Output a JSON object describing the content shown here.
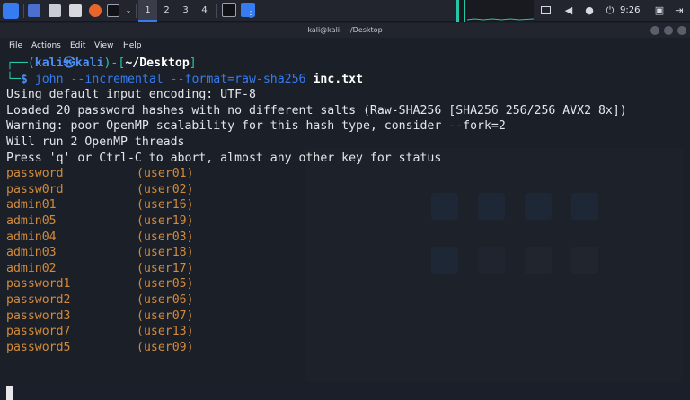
{
  "taskbar": {
    "workspaces": [
      "1",
      "2",
      "3",
      "4"
    ],
    "active_workspace": 0,
    "task_badge": "3",
    "clock": "9:26",
    "accent": "#367bf0",
    "icons": [
      "kali-menu-icon",
      "desktop-icon",
      "files-icon",
      "text-editor-icon",
      "firefox-icon",
      "terminal-icon",
      "chevron-down-icon",
      "terminal-task-icon",
      "file-manager-task-icon",
      "screen-icon",
      "volume-icon",
      "notifications-icon",
      "power-icon",
      "lock-icon",
      "logout-icon"
    ]
  },
  "window": {
    "title": "kali@kali: ~/Desktop"
  },
  "menu": {
    "file": "File",
    "actions": "Actions",
    "edit": "Edit",
    "view": "View",
    "help": "Help"
  },
  "prompt": {
    "open": "┌──(",
    "user": "kali",
    "at": "㉿",
    "host": "kali",
    "mid": ")-[",
    "path": "~/Desktop",
    "close": "]",
    "line2": "└─",
    "dollar": "$",
    "cmd": "john --incremental --format=raw-sha256",
    "arg": "inc.txt"
  },
  "output": [
    "Using default input encoding: UTF-8",
    "Loaded 20 password hashes with no different salts (Raw-SHA256 [SHA256 256/256 AVX2 8x])",
    "Warning: poor OpenMP scalability for this hash type, consider --fork=2",
    "Will run 2 OpenMP threads",
    "Press 'q' or Ctrl-C to abort, almost any other key for status"
  ],
  "cracked": [
    {
      "password": "password",
      "user": "(user01)"
    },
    {
      "password": "passw0rd",
      "user": "(user02)"
    },
    {
      "password": "admin01",
      "user": "(user16)"
    },
    {
      "password": "admin05",
      "user": "(user19)"
    },
    {
      "password": "admin04",
      "user": "(user03)"
    },
    {
      "password": "admin03",
      "user": "(user18)"
    },
    {
      "password": "admin02",
      "user": "(user17)"
    },
    {
      "password": "password1",
      "user": "(user05)"
    },
    {
      "password": "password2",
      "user": "(user06)"
    },
    {
      "password": "password3",
      "user": "(user07)"
    },
    {
      "password": "password7",
      "user": "(user13)"
    },
    {
      "password": "password5",
      "user": "(user09)"
    }
  ]
}
